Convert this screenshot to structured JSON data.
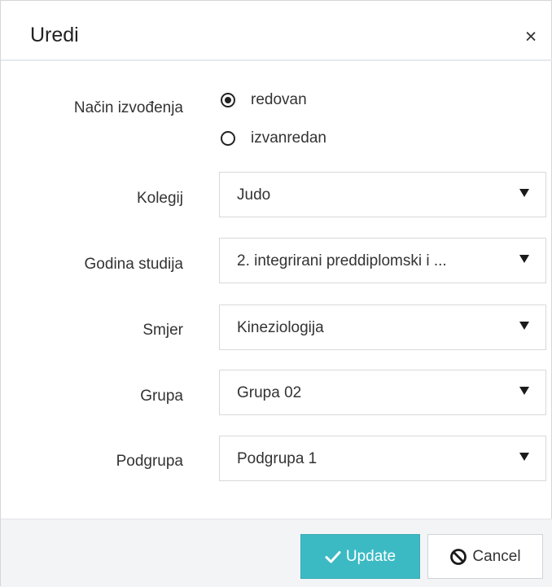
{
  "dialog": {
    "title": "Uredi",
    "close_glyph": "×",
    "close_icon": "close-icon"
  },
  "form": {
    "nacin": {
      "label": "Način izvođenja",
      "options": [
        {
          "label": "redovan",
          "checked": true
        },
        {
          "label": "izvanredan",
          "checked": false
        }
      ]
    },
    "kolegij": {
      "label": "Kolegij",
      "value": "Judo"
    },
    "godina": {
      "label": "Godina studija",
      "value": "2. integrirani preddiplomski i ..."
    },
    "smjer": {
      "label": "Smjer",
      "value": "Kineziologija"
    },
    "grupa": {
      "label": "Grupa",
      "value": "Grupa 02"
    },
    "podgrupa": {
      "label": "Podgrupa",
      "value": "Podgrupa 1"
    }
  },
  "footer": {
    "update_label": "Update",
    "update_icon": "check-icon",
    "cancel_label": "Cancel",
    "cancel_icon": "ban-icon"
  },
  "colors": {
    "update_bg": "#3cbac4",
    "footer_bg": "#f3f4f6",
    "border": "#d9d9d9"
  }
}
